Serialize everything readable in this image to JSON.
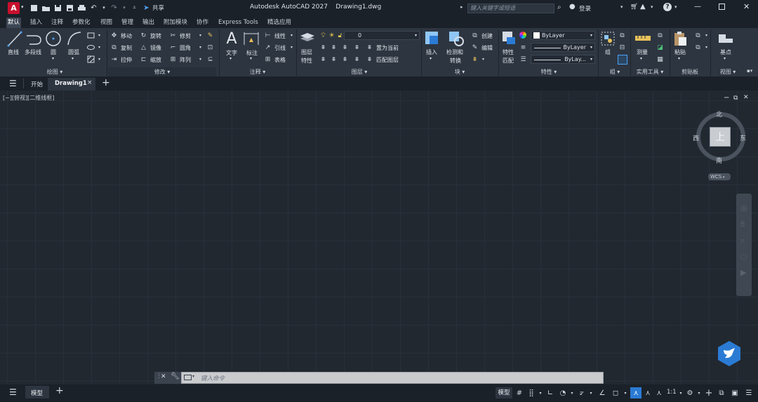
{
  "title_bar": {
    "app_title": "Autodesk AutoCAD 2027",
    "document_name": "Drawing1.dwg",
    "share_label": "共享",
    "search_placeholder": "键入关键字或短语",
    "login_label": "登录"
  },
  "ribbon_tabs": [
    "默认",
    "插入",
    "注释",
    "参数化",
    "视图",
    "管理",
    "输出",
    "附加模块",
    "协作",
    "Express Tools",
    "精选应用"
  ],
  "ribbon": {
    "draw": {
      "line": "直线",
      "polyline": "多段线",
      "circle": "圆",
      "arc": "圆弧",
      "panel": "绘图 ▾"
    },
    "modify": {
      "move": "移动",
      "rotate": "旋转",
      "trim": "修剪",
      "copy": "复制",
      "mirror": "镜像",
      "fillet": "圆角",
      "stretch": "拉伸",
      "scale": "缩放",
      "array": "阵列",
      "panel": "修改 ▾"
    },
    "annotation": {
      "text": "文字",
      "dimension": "标注",
      "linear": "线性",
      "leader": "引线",
      "table": "表格",
      "panel": "注释 ▾"
    },
    "layers": {
      "layer_props": "图层",
      "layer_props2": "特性",
      "current_layer": "0",
      "set_current": "置为当前",
      "match_layer": "匹配图层",
      "panel": "图层 ▾"
    },
    "block": {
      "insert": "插入",
      "inspect": "检测和",
      "inspect2": "转换",
      "create": "创建",
      "edit": "编辑",
      "panel": "块 ▾"
    },
    "properties": {
      "match": "特性",
      "match2": "匹配",
      "color": "ByLayer",
      "linetype": "ByLayer",
      "lineweight": "ByLay...",
      "panel": "特性 ▾"
    },
    "groups": {
      "group": "组",
      "panel": "组 ▾"
    },
    "utilities": {
      "measure": "测量",
      "panel": "实用工具 ▾"
    },
    "clipboard": {
      "paste": "粘贴",
      "panel": "剪贴板"
    },
    "view": {
      "base": "基点",
      "panel": "视图 ▾"
    }
  },
  "doc_tabs": {
    "start": "开始",
    "drawing": "Drawing1"
  },
  "viewport": {
    "label": "[−][俯视][二维线框]",
    "viewcube": {
      "north": "北",
      "south": "南",
      "east": "东",
      "west": "西",
      "top": "上",
      "wcs": "WCS"
    }
  },
  "command_line": {
    "placeholder": "键入命令"
  },
  "status_bar": {
    "model_tab": "模型",
    "model_button": "模型",
    "scale": "1:1"
  },
  "colors": {
    "accent": "#2b7bd4",
    "logo": "#c8102e",
    "canvas": "#212830",
    "ribbon": "#2d3540"
  }
}
